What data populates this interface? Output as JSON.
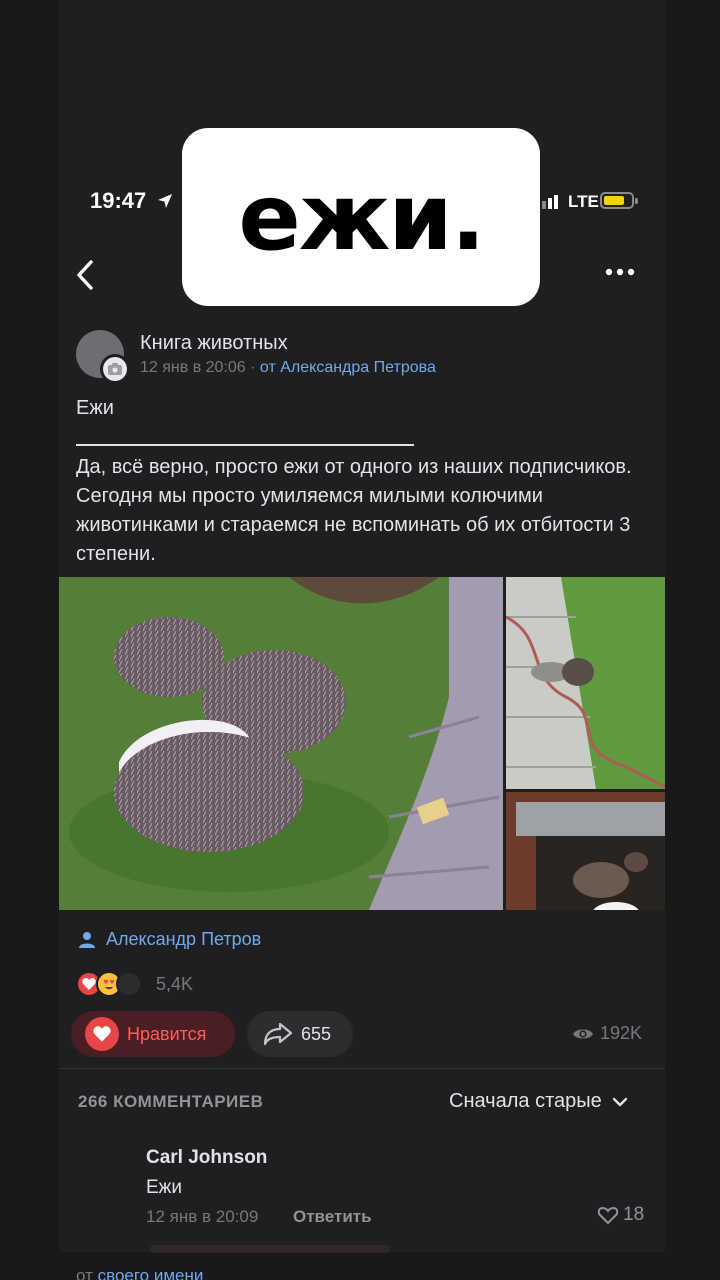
{
  "status_bar": {
    "time": "19:47",
    "network": "LTE"
  },
  "sticker": {
    "text": "ежи."
  },
  "post": {
    "group_name": "Книга животных",
    "date": "12 янв в 20:06",
    "separator": "·",
    "from_prefix": "от",
    "author": "Александра Петрова",
    "title": "Ежи",
    "text": "Да, всё верно, просто ежи от одного из наших подписчиков. Сегодня мы просто умиляемся милыми колючими животинками и стараемся не вспоминать об их отбитости 3 степени.",
    "signature": "Александр Петров",
    "reactions_count": "5,4K",
    "like_label": "Нравится",
    "shares": "655",
    "views": "192K"
  },
  "comments": {
    "count_label": "266 КОММЕНТАРИЕВ",
    "sort_label": "Сначала старые",
    "items": [
      {
        "name": "Carl Johnson",
        "text": "Ежи",
        "date": "12 янв в 20:09",
        "reply_label": "Ответить",
        "likes": "18"
      }
    ]
  },
  "footer": {
    "prefix": "от",
    "link": "своего имени"
  },
  "icons": [
    "location-arrow-icon",
    "signal-icon",
    "battery-icon",
    "back-chevron-icon",
    "more-icon",
    "camera-icon",
    "person-icon",
    "heart-icon",
    "share-arrow-icon",
    "eye-icon",
    "chevron-down-icon"
  ],
  "colors": {
    "background": "#19191b",
    "surface": "#1f1f22",
    "accent": "#71aaeb",
    "like": "#e64646",
    "battery": "#f5d20a"
  }
}
